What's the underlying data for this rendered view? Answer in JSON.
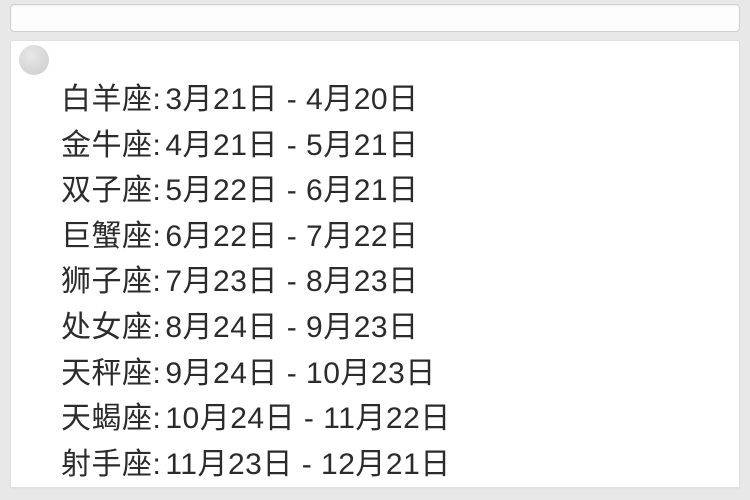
{
  "zodiac": [
    {
      "name": "白羊座",
      "range": "3月21日 - 4月20日"
    },
    {
      "name": "金牛座",
      "range": "4月21日 - 5月21日"
    },
    {
      "name": "双子座",
      "range": "5月22日 - 6月21日"
    },
    {
      "name": "巨蟹座",
      "range": "6月22日 - 7月22日"
    },
    {
      "name": "狮子座",
      "range": "7月23日 - 8月23日"
    },
    {
      "name": "处女座",
      "range": "8月24日 - 9月23日"
    },
    {
      "name": "天秤座",
      "range": "9月24日 - 10月23日"
    },
    {
      "name": "天蝎座",
      "range": "10月24日 - 11月22日"
    },
    {
      "name": "射手座",
      "range": "11月23日 - 12月21日"
    }
  ],
  "separator": ":"
}
